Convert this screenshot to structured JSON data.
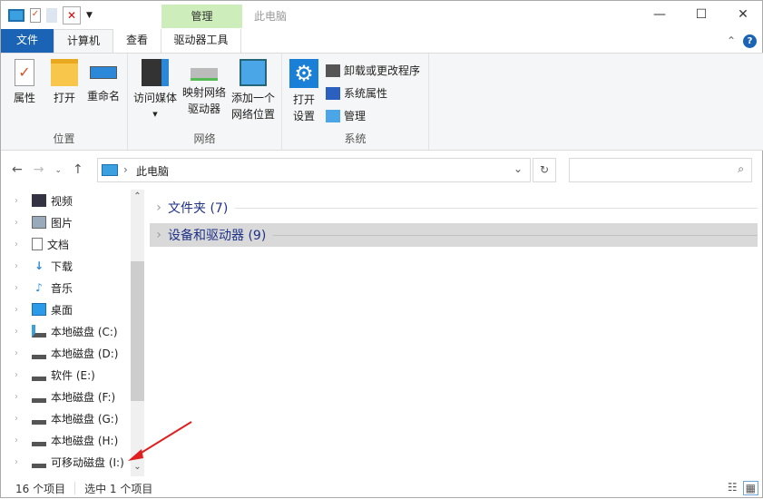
{
  "window": {
    "title": "此电脑",
    "context_tab": "管理",
    "minimize": "—",
    "maximize": "☐",
    "close": "✕"
  },
  "tabs": [
    {
      "label": "文件"
    },
    {
      "label": "计算机"
    },
    {
      "label": "查看"
    },
    {
      "label": "驱动器工具"
    }
  ],
  "ribbon": {
    "location": {
      "label": "位置",
      "items": [
        {
          "label": "属性"
        },
        {
          "label": "打开"
        },
        {
          "label": "重命名"
        }
      ]
    },
    "network": {
      "label": "网络",
      "items": [
        {
          "label": "访问媒体"
        },
        {
          "label": "映射网络\n驱动器"
        },
        {
          "label": "添加一个\n网络位置"
        }
      ]
    },
    "system": {
      "label": "系统",
      "open_settings": "打开\n设置",
      "items": [
        {
          "label": "卸载或更改程序"
        },
        {
          "label": "系统属性"
        },
        {
          "label": "管理"
        }
      ]
    }
  },
  "address": {
    "crumb": "此电脑",
    "search_placeholder": ""
  },
  "tree": [
    {
      "label": "视频"
    },
    {
      "label": "图片"
    },
    {
      "label": "文档"
    },
    {
      "label": "下载"
    },
    {
      "label": "音乐"
    },
    {
      "label": "桌面"
    },
    {
      "label": "本地磁盘 (C:)"
    },
    {
      "label": "本地磁盘 (D:)"
    },
    {
      "label": "软件 (E:)"
    },
    {
      "label": "本地磁盘 (F:)"
    },
    {
      "label": "本地磁盘 (G:)"
    },
    {
      "label": "本地磁盘 (H:)"
    },
    {
      "label": "可移动磁盘 (I:)"
    }
  ],
  "sections": [
    {
      "label": "文件夹 (7)"
    },
    {
      "label": "设备和驱动器 (9)"
    }
  ],
  "status": {
    "count": "16 个项目",
    "selected": "选中 1 个项目"
  },
  "colors": {
    "accent": "#1a63b5",
    "context": "#cdeebb",
    "arrow": "#e02020"
  }
}
